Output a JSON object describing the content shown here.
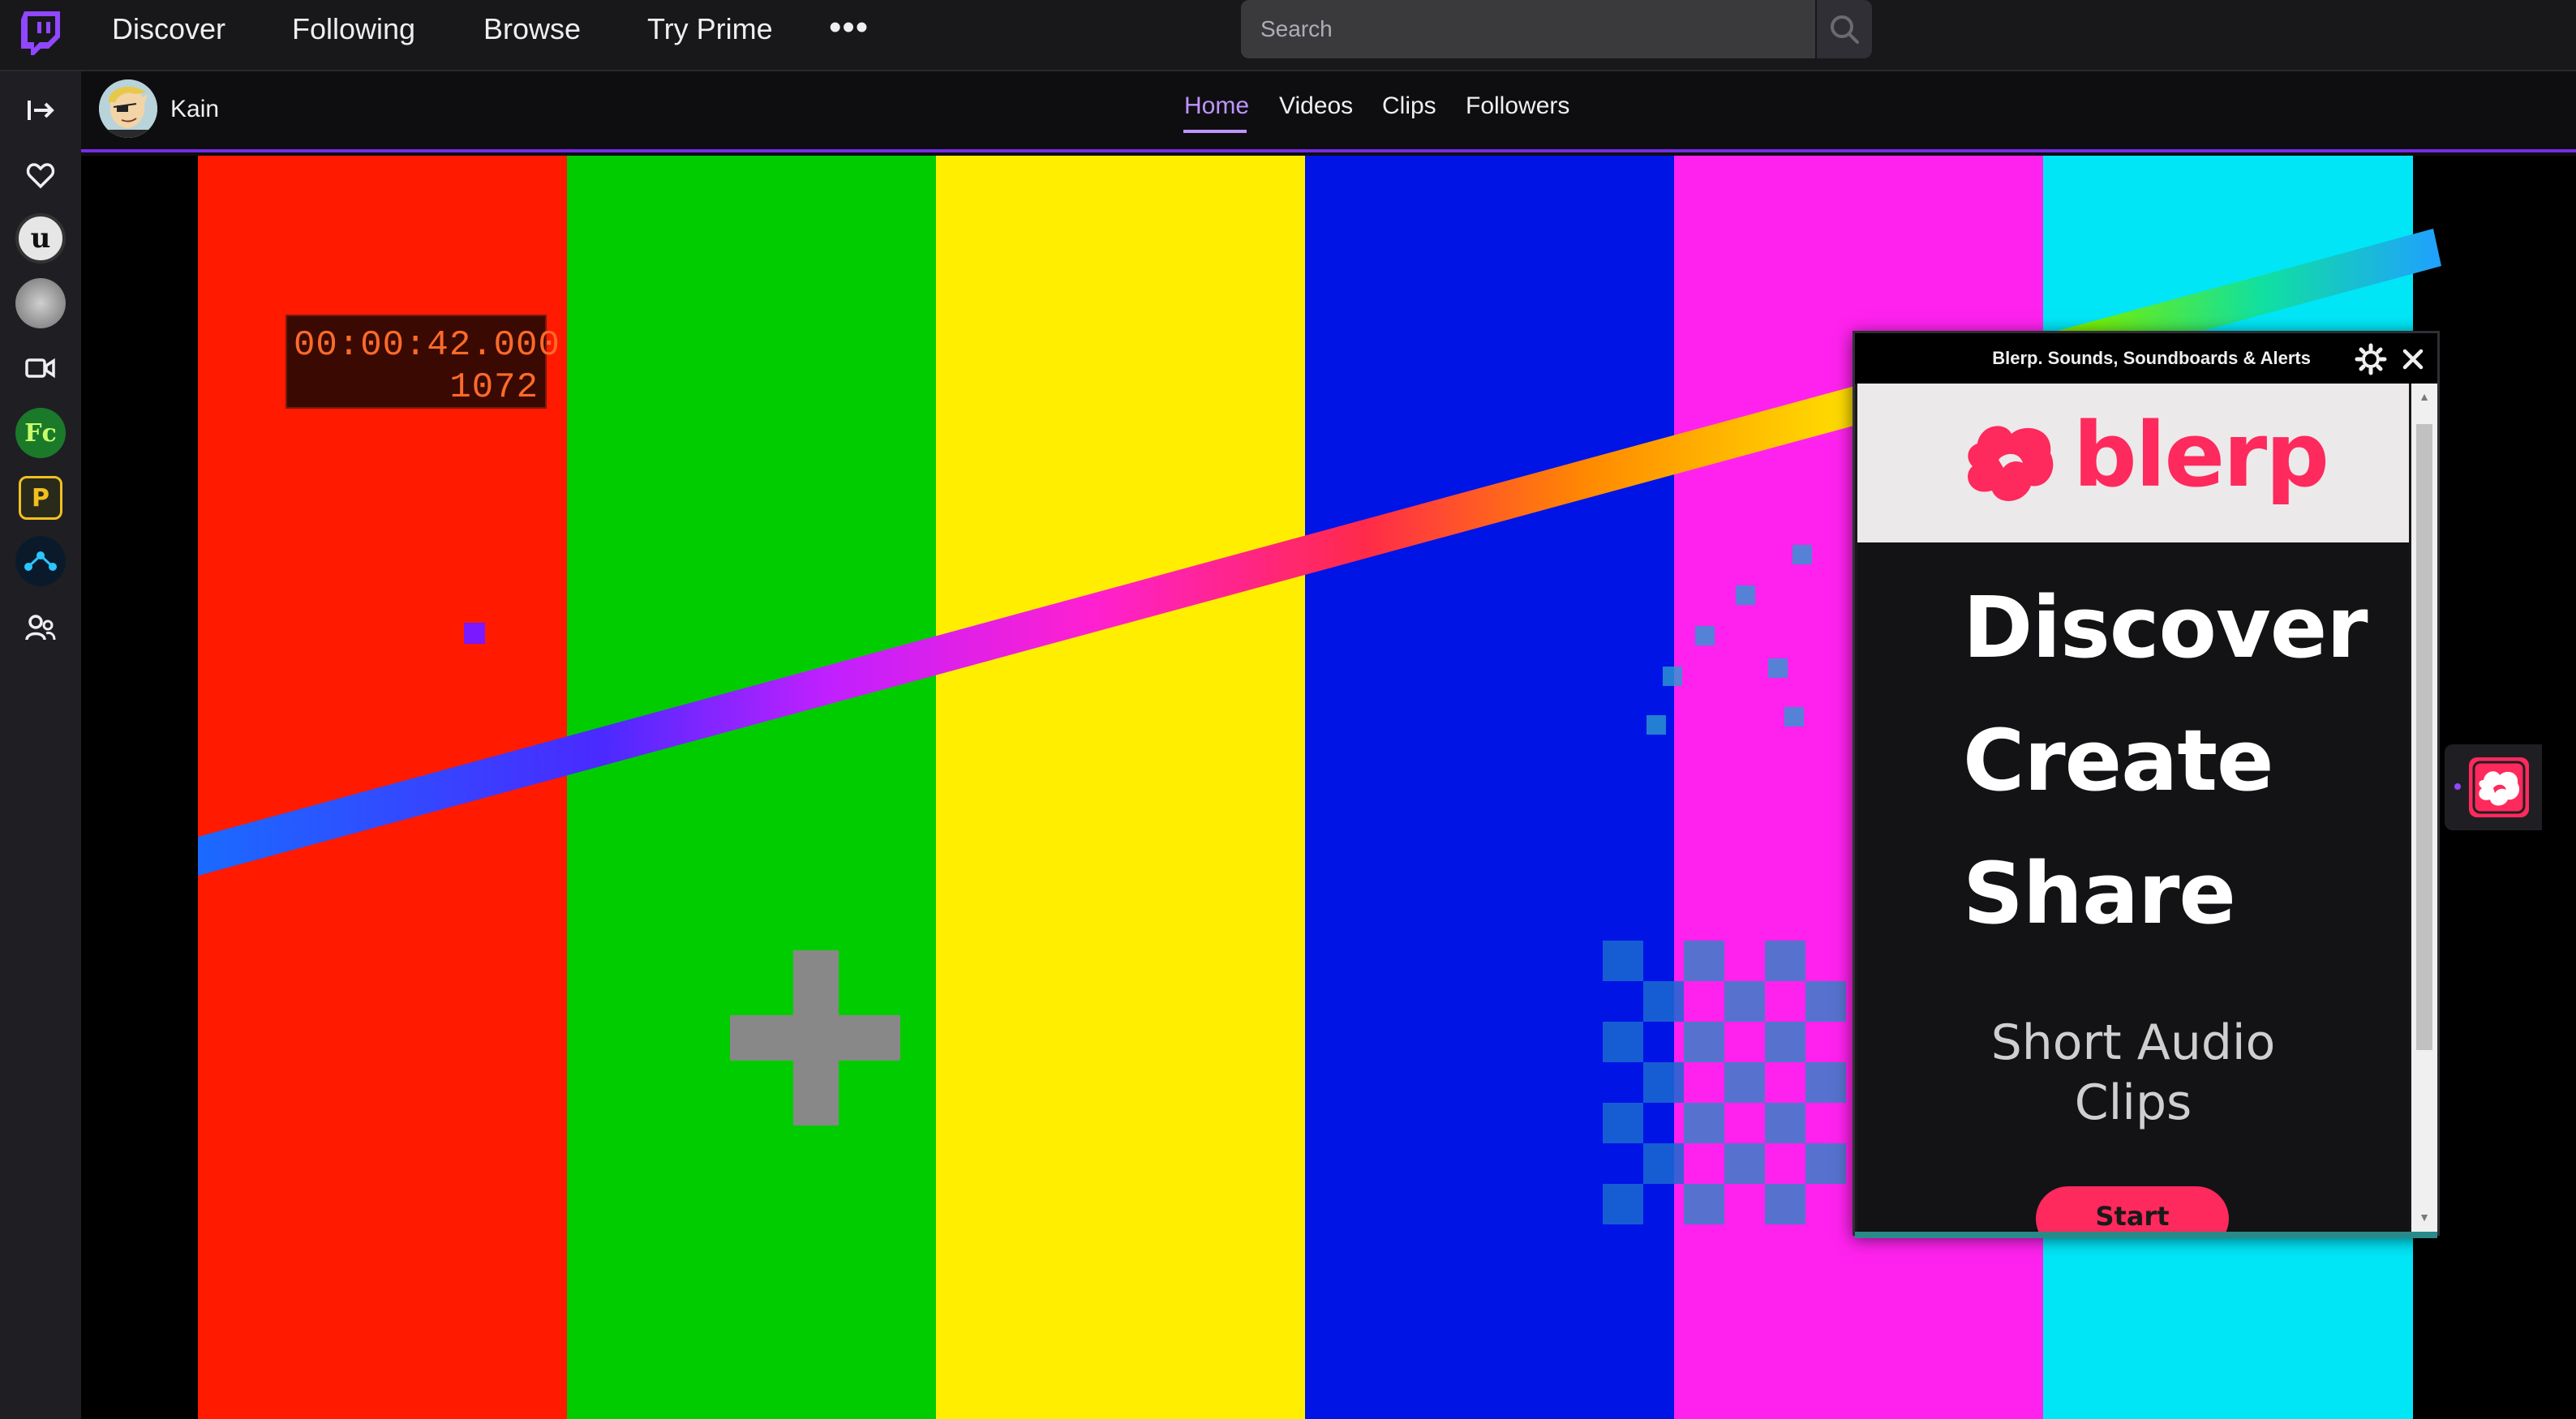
{
  "topnav": {
    "links": [
      "Discover",
      "Following",
      "Browse",
      "Try Prime"
    ],
    "more_label": "•••",
    "search_placeholder": "Search"
  },
  "sidebar": {
    "items": [
      {
        "icon": "collapse-arrow-icon"
      },
      {
        "icon": "heart-icon"
      },
      {
        "icon": "unreal-avatar"
      },
      {
        "icon": "channel-avatar"
      },
      {
        "icon": "video-camera-icon"
      },
      {
        "icon": "fc-avatar"
      },
      {
        "icon": "p-avatar"
      },
      {
        "icon": "network-avatar"
      },
      {
        "icon": "users-icon"
      }
    ]
  },
  "channel": {
    "name": "Kain",
    "tabs": [
      "Home",
      "Videos",
      "Clips",
      "Followers"
    ],
    "active_tab": "Home"
  },
  "video": {
    "timecode": "00:00:42.000",
    "frame": "1072",
    "bar_colors": [
      "#ff1a00",
      "#00cc00",
      "#ffee00",
      "#0014e6",
      "#ff22ee",
      "#00e6f7"
    ]
  },
  "extension": {
    "title": "Blerp. Sounds, Soundboards & Alerts",
    "brand": "blerp",
    "headlines": [
      "Discover",
      "Create",
      "Share"
    ],
    "subheading_lines": [
      "Short Audio",
      "Clips"
    ],
    "start_label": "Start",
    "accent": "#fe295c"
  }
}
